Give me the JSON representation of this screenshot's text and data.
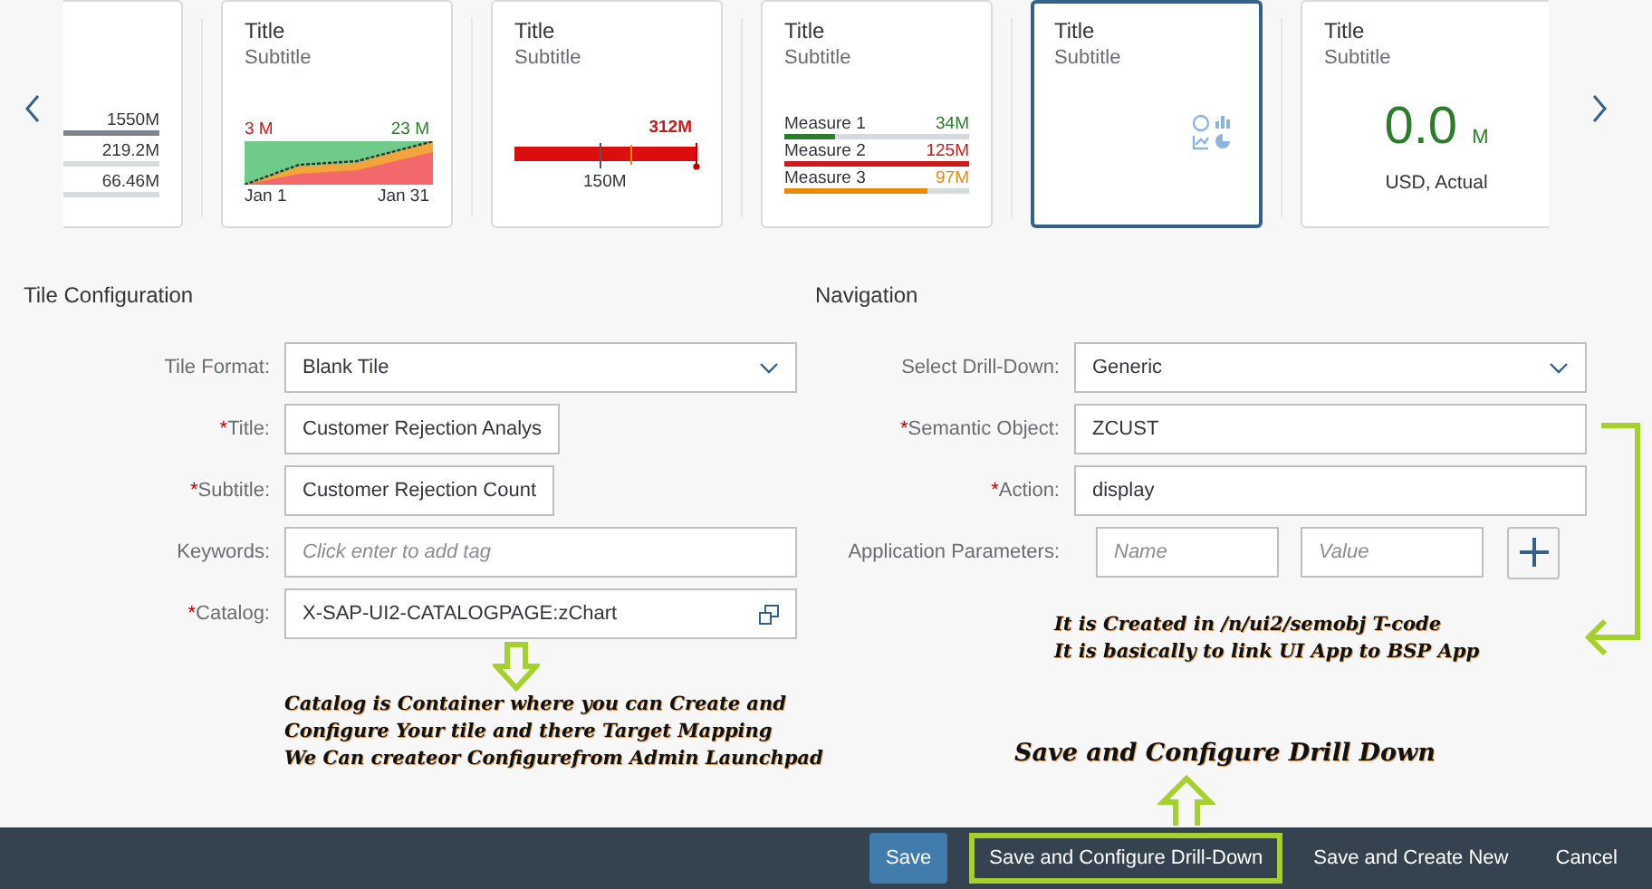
{
  "carousel": {
    "tiles": [
      {
        "kind": "comparison",
        "selected": false,
        "rows": [
          {
            "value": "1550M",
            "color": "#7d858c"
          },
          {
            "value": "219.2M",
            "color": "#d5dadd"
          },
          {
            "value": "66.46M",
            "color": "#d5dadd"
          }
        ]
      },
      {
        "kind": "area",
        "selected": false,
        "title": "Title",
        "subtitle": "Subtitle",
        "left_value": "3 M",
        "right_value": "23 M",
        "start_label": "Jan 1",
        "end_label": "Jan 31"
      },
      {
        "kind": "bullet",
        "selected": false,
        "title": "Title",
        "subtitle": "Subtitle",
        "value": "312M",
        "target_label": "150M"
      },
      {
        "kind": "stacked",
        "selected": false,
        "title": "Title",
        "subtitle": "Subtitle",
        "measures": [
          {
            "label": "Measure 1",
            "value": "34M",
            "color": "#2b7d2b",
            "level": 0.27
          },
          {
            "label": "Measure 2",
            "value": "125M",
            "color": "#cc1919",
            "level": 1
          },
          {
            "label": "Measure 3",
            "value": "97M",
            "color": "#e78c07",
            "level": 0.77
          }
        ]
      },
      {
        "kind": "blank",
        "selected": true,
        "title": "Title",
        "subtitle": "Subtitle"
      },
      {
        "kind": "numeric",
        "selected": false,
        "title": "Title",
        "subtitle": "Subtitle",
        "value": "0.0",
        "unit": "M",
        "footer": "USD, Actual"
      }
    ]
  },
  "tile_configuration": {
    "heading": "Tile Configuration",
    "fields": [
      {
        "kind": "select",
        "label": "Tile Format:",
        "value": "Blank Tile"
      },
      {
        "kind": "input",
        "label": "Title:",
        "required_mark": "*",
        "value": "Customer Rejection Analys"
      },
      {
        "kind": "input",
        "label": "Subtitle:",
        "required_mark": "*",
        "value": "Customer Rejection Count"
      },
      {
        "kind": "tags",
        "label": "Keywords:",
        "placeholder": "Click enter to add tag"
      },
      {
        "kind": "catalog",
        "label": "Catalog:",
        "required_mark": "*",
        "value": "X-SAP-UI2-CATALOGPAGE:zChart"
      }
    ]
  },
  "navigation": {
    "heading": "Navigation",
    "fields": [
      {
        "kind": "select",
        "label": "Select Drill-Down:",
        "value": "Generic"
      },
      {
        "kind": "input",
        "label": "Semantic Object:",
        "required_mark": "*",
        "value": "ZCUST"
      },
      {
        "kind": "input",
        "label": "Action:",
        "required_mark": "*",
        "value": "display"
      },
      {
        "kind": "params",
        "label": "Application Parameters:",
        "name_placeholder": "Name",
        "value_placeholder": "Value"
      }
    ]
  },
  "annotations": {
    "catalog_note": [
      "Catalog is Container where you can Create and",
      "Configure Your tile and there Target Mapping",
      "We Can createor Configurefrom Admin Launchpad"
    ],
    "semantic_note": [
      "It is Created in /n/ui2/semobj T-code",
      "It is basically to link UI App to BSP App"
    ],
    "drilldown_note": "Save and Configure Drill Down"
  },
  "footer": {
    "buttons": [
      {
        "label": "Save",
        "kind": "emphasized",
        "highlighted": false
      },
      {
        "label": "Save and Configure Drill-Down",
        "kind": "plain",
        "highlighted": true
      },
      {
        "label": "Save and Create New",
        "kind": "plain",
        "highlighted": false
      },
      {
        "label": "Cancel",
        "kind": "plain",
        "highlighted": false
      }
    ]
  }
}
